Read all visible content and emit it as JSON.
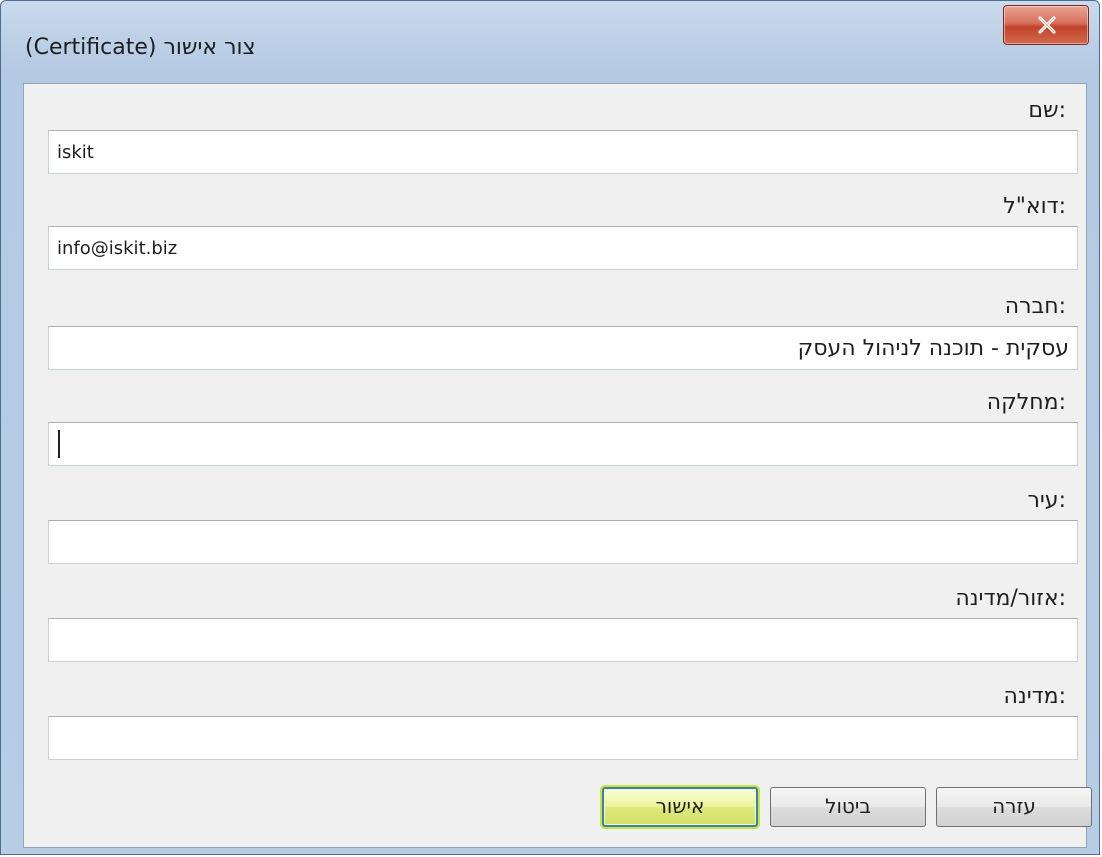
{
  "window": {
    "title": "צור אישור (Certificate)",
    "close_label": "x"
  },
  "fields": {
    "name": {
      "label": ":שם",
      "value": "iskit"
    },
    "email": {
      "label": ":דוא\"ל",
      "value": "info@iskit.biz"
    },
    "company": {
      "label": ":חברה",
      "value": "עסקית - תוכנה לניהול העסק"
    },
    "department": {
      "label": ":מחלקה",
      "value": ""
    },
    "city": {
      "label": ":עיר",
      "value": ""
    },
    "region": {
      "label": ":אזור/מדינה",
      "value": ""
    },
    "country": {
      "label": ":מדינה",
      "value": ""
    }
  },
  "buttons": {
    "ok": "אישור",
    "cancel": "ביטול",
    "help": "עזרה"
  },
  "colors": {
    "title_bar": "#bcd0e6",
    "close_button": "#c2432a",
    "default_button_glow": "#c7e63a"
  }
}
